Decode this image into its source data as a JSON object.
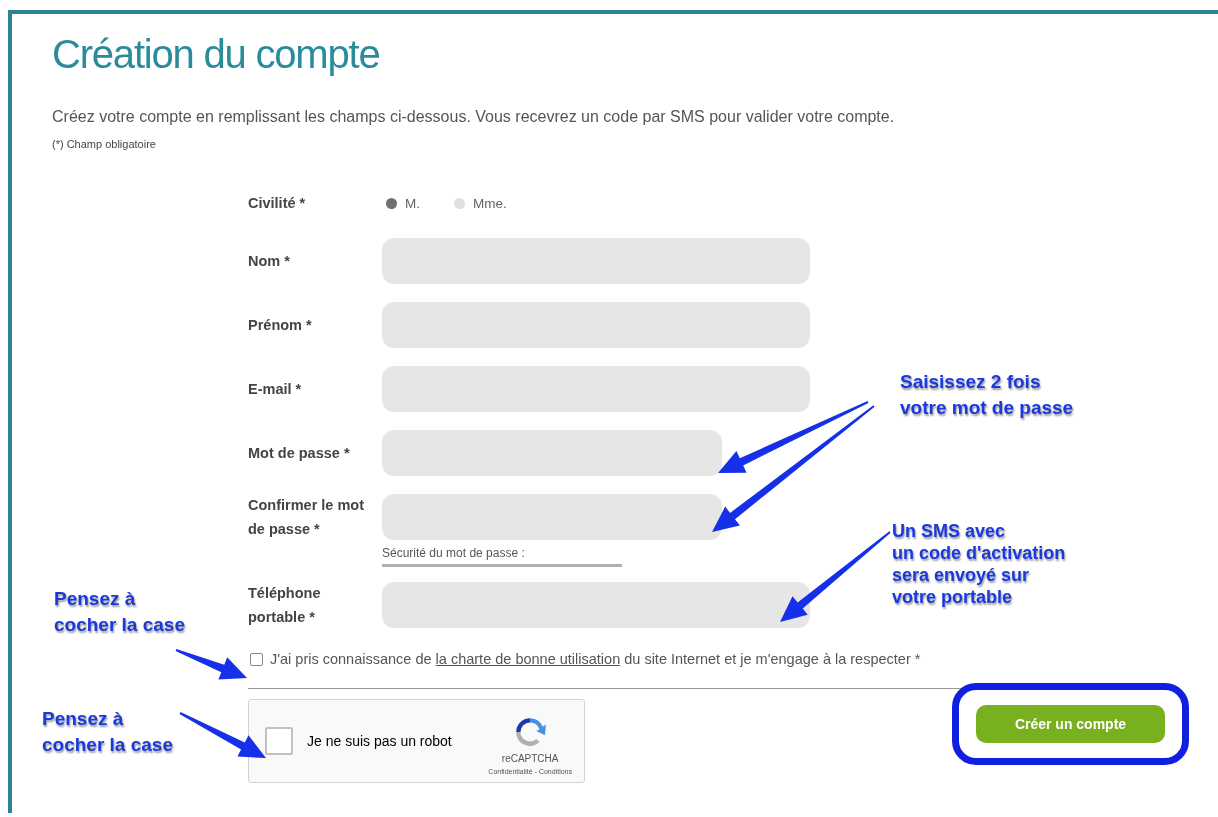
{
  "title": "Création du compte",
  "intro": "Créez votre compte en remplissant les champs ci-dessous. Vous recevrez un code par SMS pour valider votre compte.",
  "required_note": "(*) Champ obligatoire",
  "form": {
    "civility": {
      "label": "Civilité *",
      "options": [
        {
          "label": "M.",
          "selected": true
        },
        {
          "label": "Mme.",
          "selected": false
        }
      ]
    },
    "fields": [
      {
        "label": "Nom *",
        "kind": "text"
      },
      {
        "label": "Prénom *",
        "kind": "text"
      },
      {
        "label": "E-mail *",
        "kind": "text"
      },
      {
        "label": "Mot de passe *",
        "kind": "password"
      },
      {
        "label": "Confirmer le mot de passe *",
        "kind": "password",
        "hint": "Sécurité du mot de passe :"
      },
      {
        "label": "Téléphone portable *",
        "kind": "phone"
      }
    ],
    "terms": {
      "checked": false,
      "before": "J'ai pris connaissance de ",
      "link": "la charte de bonne utilisation",
      "after": " du site Internet et je m'engage à la respecter *"
    },
    "captcha": {
      "checked": false,
      "label": "Je ne suis pas un robot",
      "brand": "reCAPTCHA",
      "footer": "Confidentialité - Conditions"
    },
    "submit": {
      "label": "Créer un compte",
      "highlighted": true
    }
  },
  "annotations": [
    {
      "text": "Saisissez 2 fois\nvotre mot de passe"
    },
    {
      "text": "Un SMS avec\nun code d'activation\nsera envoyé sur\nvotre portable"
    },
    {
      "text": "Pensez à\ncocher la case"
    },
    {
      "text": "Pensez à\ncocher la case"
    }
  ]
}
